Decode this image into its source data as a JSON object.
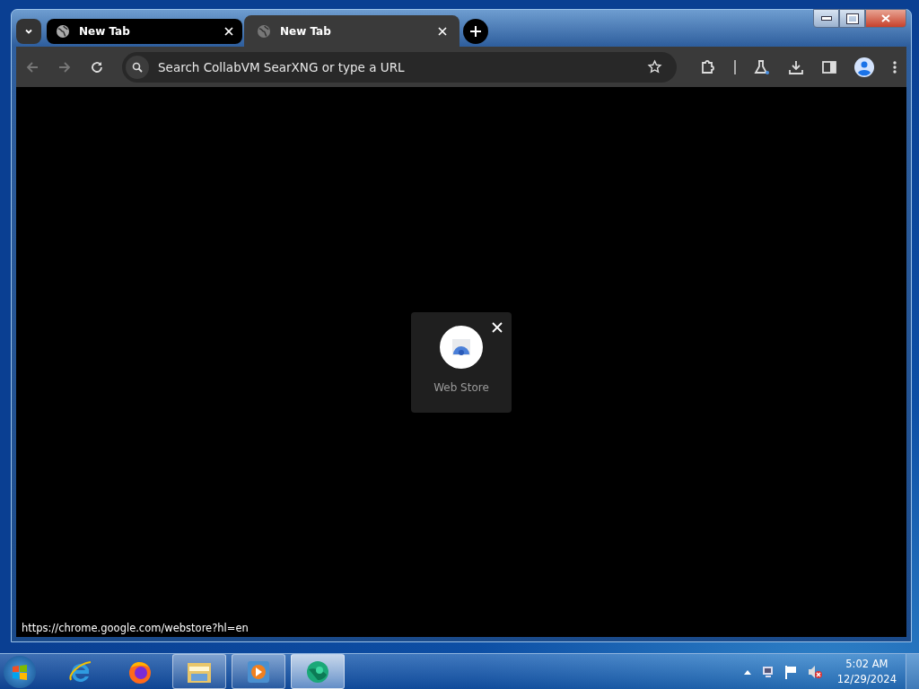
{
  "browser": {
    "tabs": [
      {
        "title": "New Tab",
        "selected": false
      },
      {
        "title": "New Tab",
        "selected": true
      }
    ],
    "omnibox": {
      "placeholder": "Search CollabVM SearXNG or type a URL"
    },
    "shortcut": {
      "label": "Web Store"
    },
    "status_url": "https://chrome.google.com/webstore?hl=en"
  },
  "taskbar": {
    "apps": [
      {
        "kind": "ie",
        "running": false,
        "selected": false
      },
      {
        "kind": "firefox",
        "running": false,
        "selected": false
      },
      {
        "kind": "explorer",
        "running": true,
        "selected": false
      },
      {
        "kind": "media",
        "running": true,
        "selected": false
      },
      {
        "kind": "chrome",
        "running": true,
        "selected": true
      }
    ],
    "time": "5:02 AM",
    "date": "12/29/2024"
  }
}
